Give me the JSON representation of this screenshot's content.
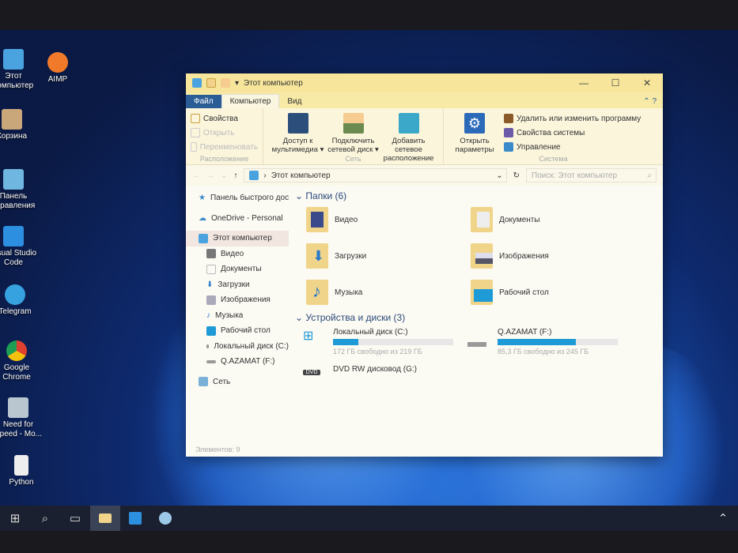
{
  "desktop": {
    "icons": [
      "Этот компьютер",
      "AIMP",
      "Корзина",
      "Панель управления",
      "Visual Studio Code",
      "Telegram",
      "Google Chrome",
      "Need for Speed - Mo...",
      "Python"
    ]
  },
  "window": {
    "title": "Этот компьютер",
    "minimize": "—",
    "maximize": "☐",
    "close": "✕"
  },
  "tabs": [
    "Файл",
    "Компьютер",
    "Вид"
  ],
  "ribbon": {
    "location": {
      "label": "Расположение",
      "items": [
        "Свойства",
        "Открыть",
        "Переименовать"
      ]
    },
    "network": {
      "label": "Сеть",
      "items": [
        "Доступ к мультимедиа ▾",
        "Подключить сетевой диск ▾",
        "Добавить сетевое расположение"
      ]
    },
    "open_settings": "Открыть параметры",
    "system": {
      "label": "Система",
      "items": [
        "Удалить или изменить программу",
        "Свойства системы",
        "Управление"
      ]
    }
  },
  "address": {
    "path": "Этот компьютер",
    "search_placeholder": "Поиск: Этот компьютер"
  },
  "nav": {
    "items": [
      "Панель быстрого доступа",
      "OneDrive - Personal",
      "Этот компьютер",
      "Видео",
      "Документы",
      "Загрузки",
      "Изображения",
      "Музыка",
      "Рабочий стол",
      "Локальный диск (C:)",
      "Q.AZAMAT (F:)",
      "Сеть"
    ]
  },
  "folders": {
    "header": "Папки (6)",
    "items": [
      "Видео",
      "Документы",
      "Загрузки",
      "Изображения",
      "Музыка",
      "Рабочий стол"
    ]
  },
  "drives": {
    "header": "Устройства и диски (3)",
    "items": [
      {
        "name": "Локальный диск (C:)",
        "free": "172 ГБ свободно из 219 ГБ",
        "used_pct": 21
      },
      {
        "name": "Q.AZAMAT (F:)",
        "free": "85,3 ГБ свободно из 245 ГБ",
        "used_pct": 65
      },
      {
        "name": "DVD RW дисковод (G:)"
      }
    ]
  },
  "status": "Элементов: 9"
}
